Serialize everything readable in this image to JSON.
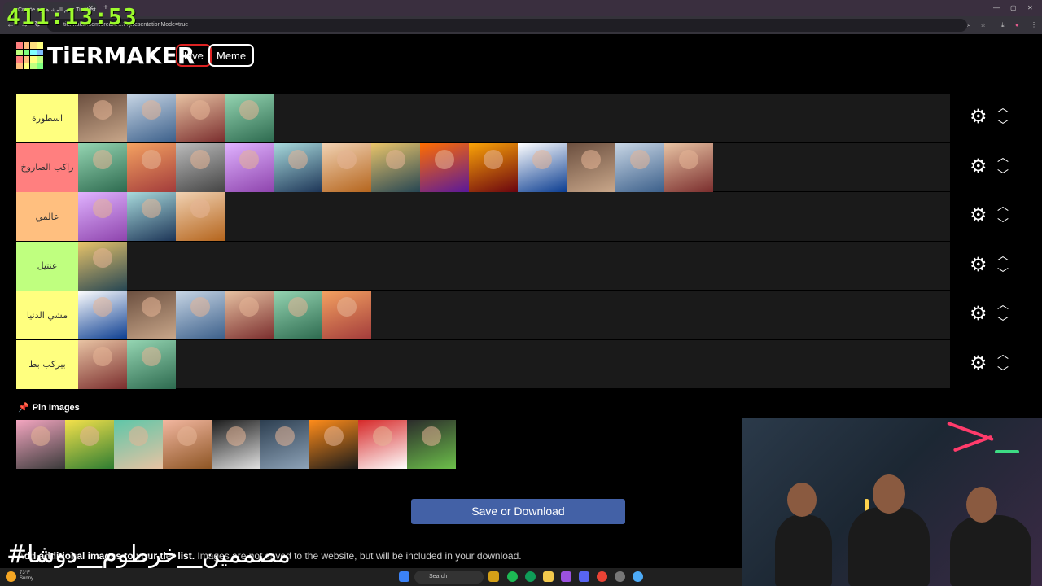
{
  "browser": {
    "tab_title": "Create a تقيم المشاهير Tier List",
    "url": "tiermaker.com/create/...77presentationMode=true",
    "clock": "411:13:53"
  },
  "header": {
    "logo_text": "TiERMAKER",
    "live_label": "Live",
    "meme_label": "Meme"
  },
  "tiers": [
    {
      "label": "اسطورة",
      "color": "#ffff7f",
      "image_count": 4
    },
    {
      "label": "راكب الصاروخ",
      "color": "#ff7f7f",
      "image_count": 13
    },
    {
      "label": "عالمي",
      "color": "#ffbf7f",
      "image_count": 3
    },
    {
      "label": "عنتيل",
      "color": "#bfff7f",
      "image_count": 1
    },
    {
      "label": "مشي الدنيا",
      "color": "#ffff7f",
      "image_count": 6
    },
    {
      "label": "بيركب بط",
      "color": "#ffff7f",
      "image_count": 2
    }
  ],
  "tier_controls": {
    "settings_icon": "gear-icon",
    "up_icon": "chevron-up-icon",
    "down_icon": "chevron-down-icon"
  },
  "pool": {
    "title": "Pin Images",
    "icon": "pin-icon",
    "image_count": 9
  },
  "save_button": "Save or Download",
  "note": {
    "bold": "Add additional images to your tier list.",
    "rest": " Images are not saved to the website, but will be included in your download."
  },
  "overlay_text": "#مصممين__خرطوم__دوشا",
  "taskbar": {
    "search_placeholder": "Search",
    "temperature": "73°F",
    "weather": "Sunny"
  }
}
